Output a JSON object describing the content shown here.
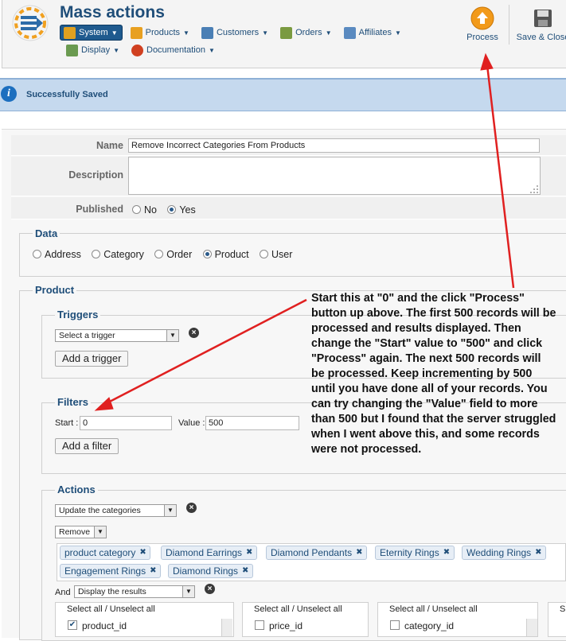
{
  "header": {
    "title": "Mass actions",
    "menu_row1": [
      {
        "label": "System",
        "icon": "tools-icon",
        "color": "#e0a020",
        "active": true
      },
      {
        "label": "Products",
        "icon": "box-icon",
        "color": "#e8a020"
      },
      {
        "label": "Customers",
        "icon": "users-icon",
        "color": "#4a7fb5"
      },
      {
        "label": "Orders",
        "icon": "order-icon",
        "color": "#7a9a40"
      },
      {
        "label": "Affiliates",
        "icon": "affiliate-icon",
        "color": "#5a8ac0"
      }
    ],
    "menu_row2": [
      {
        "label": "Display",
        "icon": "display-icon",
        "color": "#6a9a50"
      },
      {
        "label": "Documentation",
        "icon": "lifebuoy-icon",
        "color": "#d04020"
      }
    ],
    "toolbar": {
      "process_label": "Process",
      "save_close_label": "Save & Close"
    }
  },
  "message": {
    "text": "Successfully Saved"
  },
  "form": {
    "name_label": "Name",
    "name_value": "Remove Incorrect Categories From Products",
    "description_label": "Description",
    "description_value": "",
    "published_label": "Published",
    "published_options": [
      "No",
      "Yes"
    ],
    "published_selected": "Yes"
  },
  "data_section": {
    "legend": "Data",
    "options": [
      "Address",
      "Category",
      "Order",
      "Product",
      "User"
    ],
    "selected": "Product"
  },
  "product_section": {
    "legend": "Product",
    "triggers": {
      "legend": "Triggers",
      "select_value": "Select a trigger",
      "add_label": "Add a trigger"
    },
    "filters": {
      "legend": "Filters",
      "start_label": "Start :",
      "start_value": "0",
      "value_label": "Value :",
      "value_value": "500",
      "add_label": "Add a filter"
    },
    "actions": {
      "legend": "Actions",
      "action_select": "Update the categories",
      "mode_select": "Remove",
      "tags_row1": [
        "product category",
        "Diamond Earrings",
        "Diamond Pendants",
        "Eternity Rings",
        "Wedding Rings"
      ],
      "tags_row2": [
        "Engagement Rings",
        "Diamond Rings"
      ],
      "and_label": "And",
      "display_select": "Display the results",
      "columns": [
        {
          "head": "Select all / Unselect all",
          "item": "product_id",
          "checked": true
        },
        {
          "head": "Select all / Unselect all",
          "item": "price_id",
          "checked": false
        },
        {
          "head": "Select all / Unselect all",
          "item": "category_id",
          "checked": false
        },
        {
          "head": "S",
          "item": "",
          "checked": false
        }
      ]
    }
  },
  "annotation": {
    "text": "Start this at \"0\" and the click \"Process\" button up above. The first 500 records will be processed and results displayed. Then change the \"Start\" value to \"500\" and click \"Process\" again. The next 500 records will be processed. Keep incrementing by 500 until you have done all of your records. You can try changing the \"Value\" field to more than 500 but I found that the server struggled when I went above this, and some records were not processed.",
    "arrow_color": "#e02020"
  }
}
